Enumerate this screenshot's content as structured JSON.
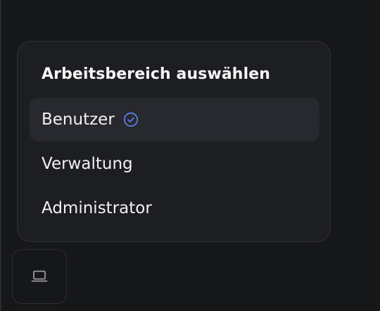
{
  "workspace_menu": {
    "title": "Arbeitsbereich auswählen",
    "items": [
      {
        "label": "Benutzer",
        "selected": true
      },
      {
        "label": "Verwaltung",
        "selected": false
      },
      {
        "label": "Administrator",
        "selected": false
      }
    ]
  },
  "icons": {
    "selected_indicator": "check-circle-icon",
    "workspace_button": "laptop-icon"
  },
  "colors": {
    "background": "#161719",
    "panel": "#1d1e21",
    "selected_row": "#28292e",
    "accent": "#5b7ee8",
    "icon_muted": "#9a9ca3"
  }
}
